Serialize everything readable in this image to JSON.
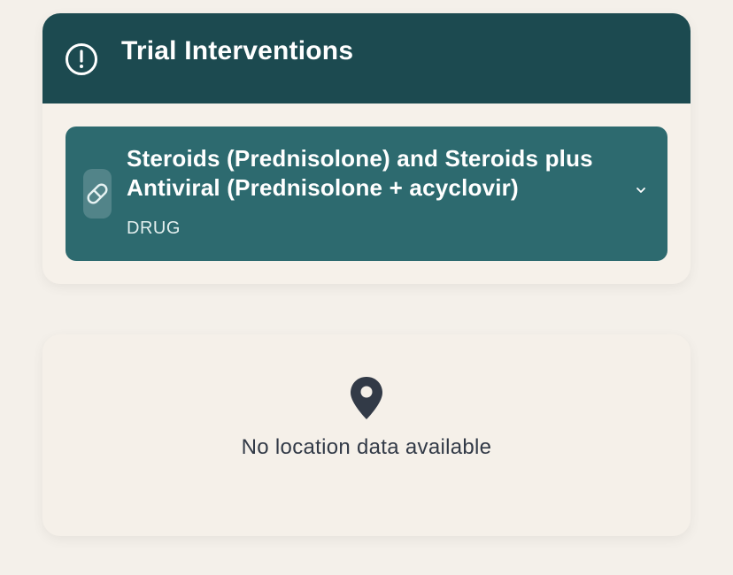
{
  "interventions": {
    "title": "Trial Interventions",
    "header_icon": "alert-circle-icon",
    "items": [
      {
        "name": "Steroids (Prednisolone) and Steroids plus Antiviral (Prednisolone + acyclovir)",
        "type": "DRUG",
        "icon": "pill-icon",
        "expand_icon": "chevron-down-icon"
      }
    ]
  },
  "location": {
    "icon": "map-pin-icon",
    "message": "No location data available"
  },
  "colors": {
    "page_background": "#f4f0ea",
    "header_background": "#1c4a50",
    "item_background": "#2d6a6f",
    "text_dark": "#323a47",
    "text_light": "#ffffff"
  }
}
